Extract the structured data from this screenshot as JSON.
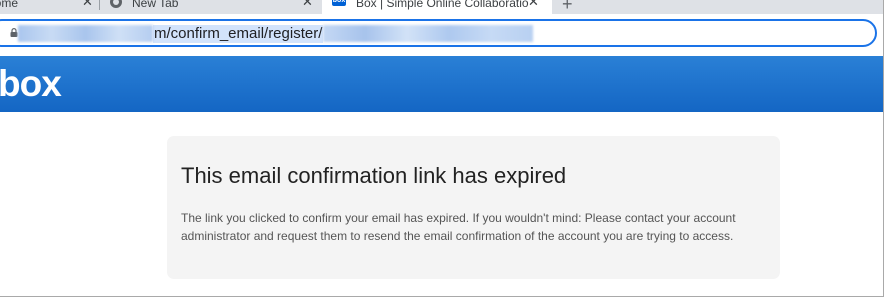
{
  "browser": {
    "tabs": [
      {
        "title": "Home",
        "icon": "none",
        "active": false
      },
      {
        "title": "New Tab",
        "icon": "chrome-icon",
        "active": false
      },
      {
        "title": "Box | Simple Online Collaboratio",
        "icon": "box-favicon",
        "favicon_text": "box",
        "active": true
      }
    ],
    "tab_close_glyph": "✕",
    "new_tab_glyph": "+",
    "address": {
      "url_visible": "m/confirm_email/register/",
      "focus_color": "#1a73e8"
    }
  },
  "header": {
    "logo_text": "box",
    "background_color": "#1a6fcc"
  },
  "message": {
    "title": "This email confirmation link has expired",
    "body": "The link you clicked to confirm your email has expired. If you wouldn't mind: Please contact your account administrator and request them to resend the email confirmation of the account you are trying to access."
  }
}
